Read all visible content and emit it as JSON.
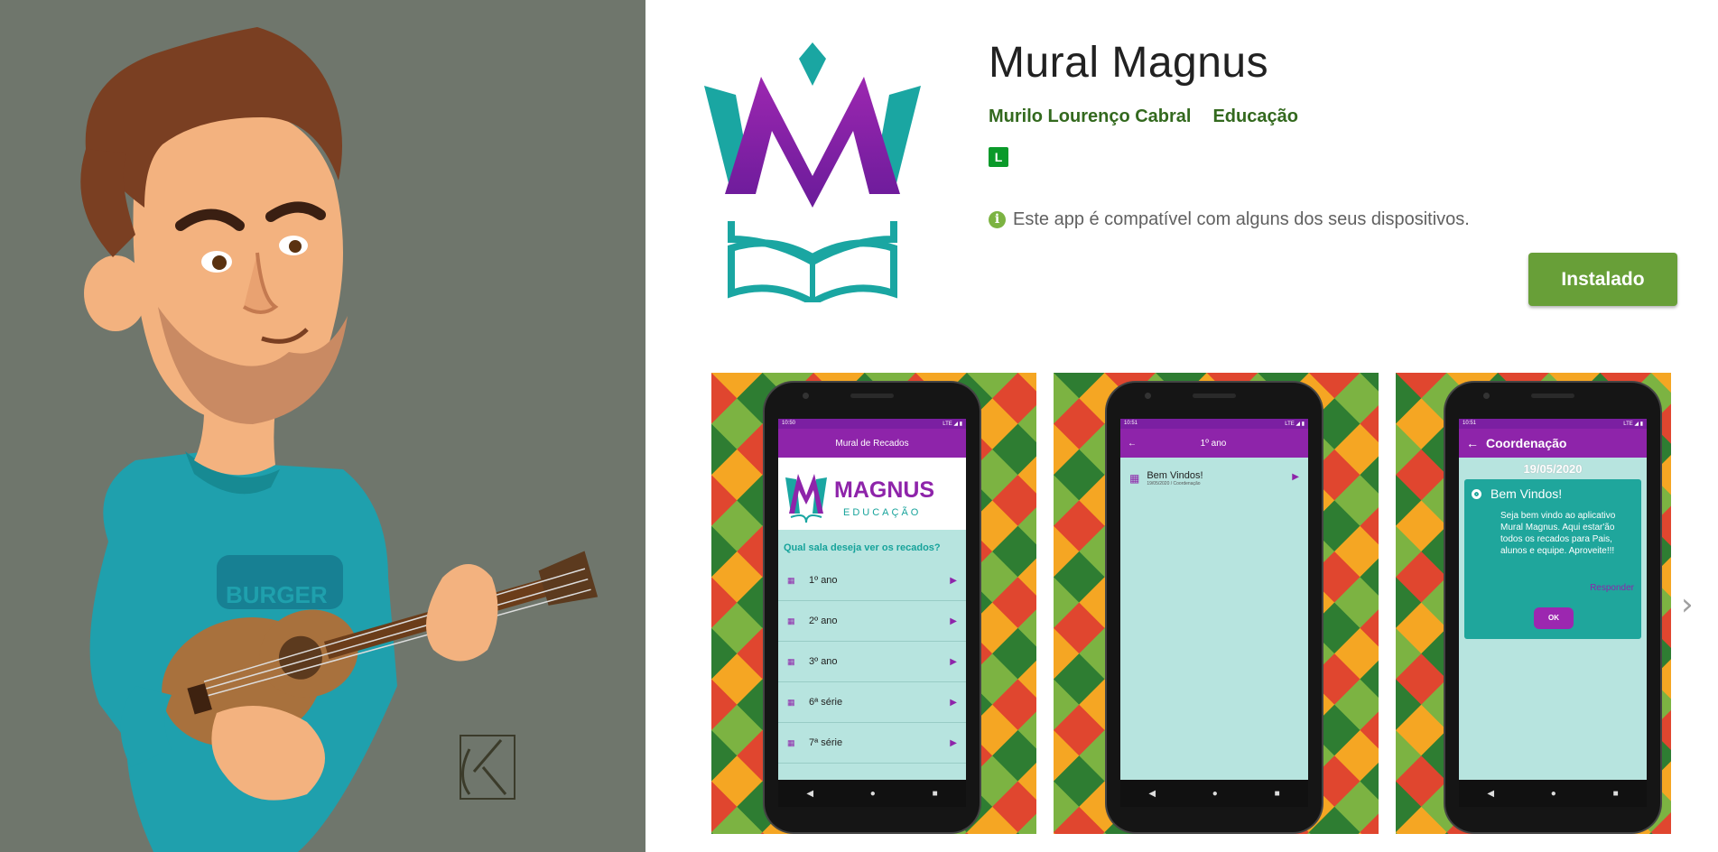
{
  "app": {
    "title": "Mural Magnus",
    "developer": "Murilo Lourenço Cabral",
    "category": "Educação",
    "content_rating": "L",
    "compat_message": "Este app é compatível com alguns dos seus dispositivos.",
    "install_label": "Instalado"
  },
  "icons": {
    "info": "info-icon",
    "next": "chevron-right-icon"
  },
  "colors": {
    "accent_green": "#689f38",
    "dev_green": "#33691e",
    "purple": "#8e24aa",
    "teal": "#17a39b"
  },
  "screenshots": {
    "s1": {
      "status_time": "10:50",
      "status_right": "LTE ◢ ▮",
      "appbar_title": "Mural de Recados",
      "logo_word": "MAGNUS",
      "logo_sub": "EDUCAÇÃO",
      "question": "Qual sala deseja ver os recados?",
      "rows": [
        "1º ano",
        "2º ano",
        "3º ano",
        "6ª série",
        "7ª série"
      ]
    },
    "s2": {
      "status_time": "10:51",
      "status_right": "LTE ◢ ▮",
      "appbar_title": "1º ano",
      "message_title": "Bem Vindos!",
      "message_sub": "19/05/2020 / Coordenação"
    },
    "s3": {
      "status_time": "10:51",
      "status_right": "LTE ◢ ▮",
      "appbar_title": "Coordenação",
      "date": "19/05/2020",
      "dialog_title": "Bem Vindos!",
      "dialog_body": "Seja bem vindo ao aplicativo Mural Magnus. Aqui estar'ão todos os recados para Pais, alunos e equipe. Aproveite!!!",
      "reply": "Responder",
      "ok": "OK"
    }
  }
}
